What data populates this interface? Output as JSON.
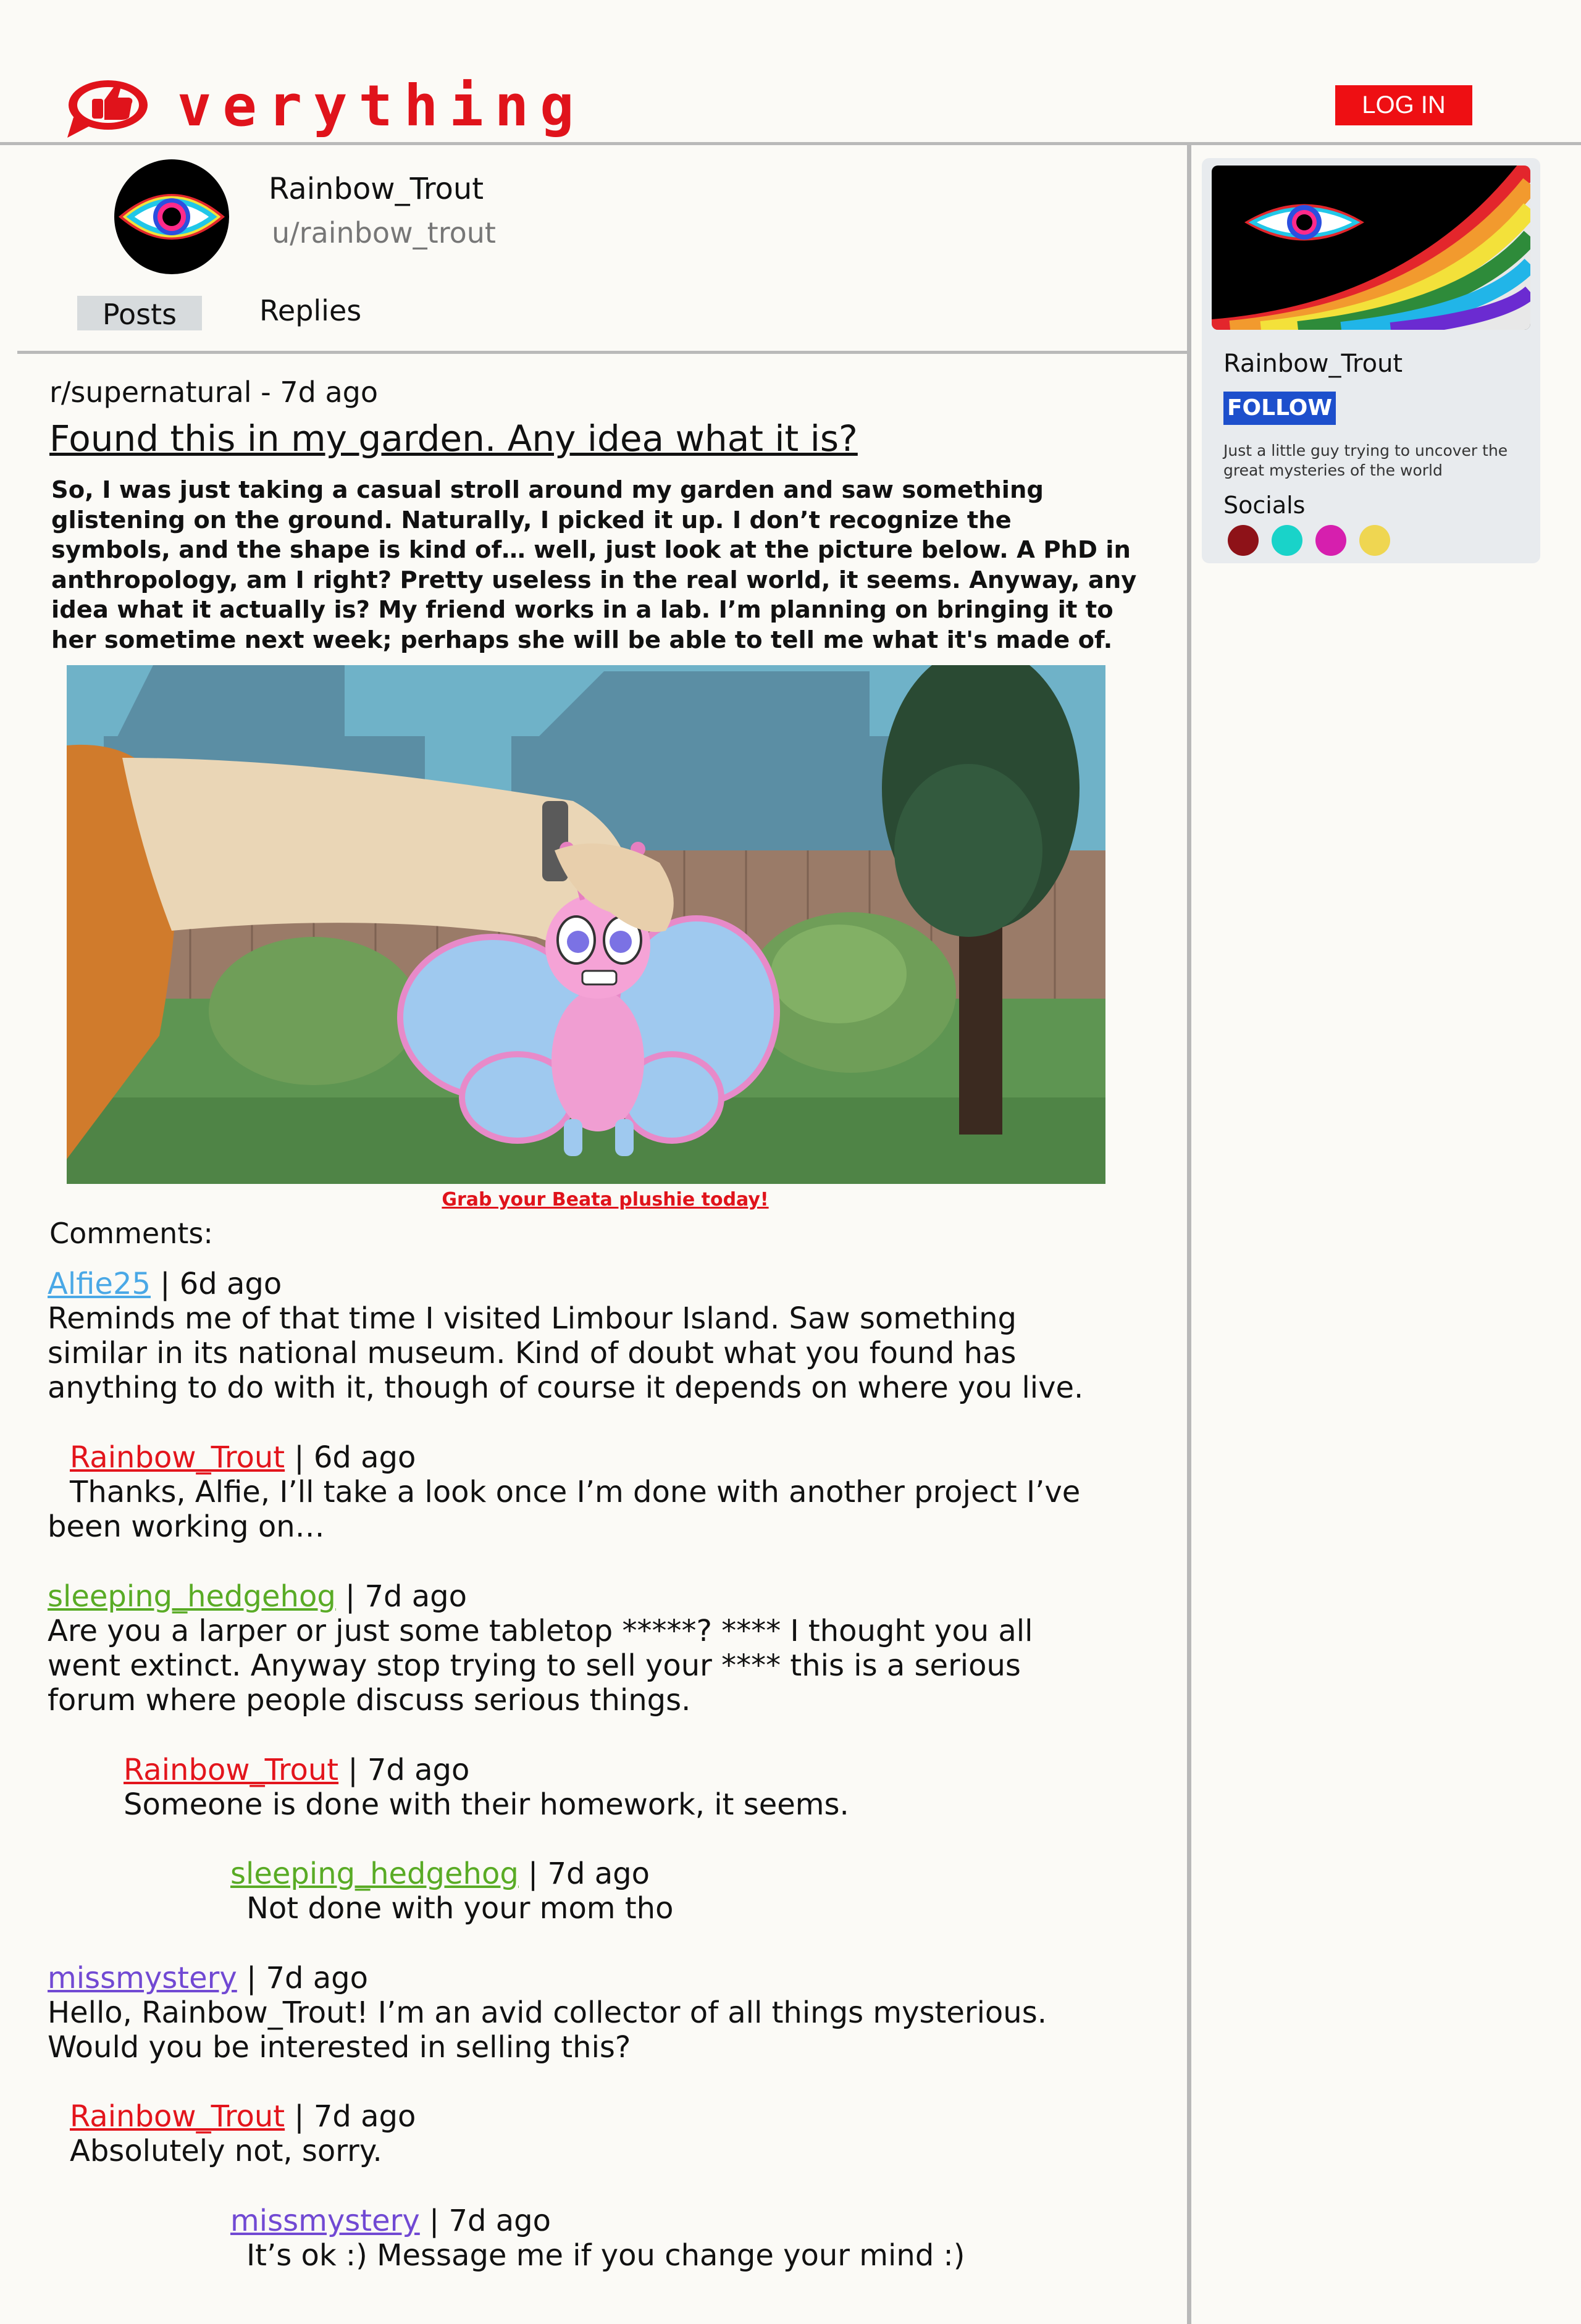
{
  "header": {
    "logo_text": "verything",
    "login_label": "LOG IN"
  },
  "profile": {
    "display_name": "Rainbow_Trout",
    "handle": "u/rainbow_trout",
    "tabs": [
      {
        "label": "Posts",
        "active": true
      },
      {
        "label": "Replies",
        "active": false
      }
    ]
  },
  "post": {
    "meta": "r/supernatural - 7d ago",
    "title": "Found this in my garden. Any idea what it is?",
    "body": "So, I was just taking a casual stroll around my garden and saw something glistening on the ground. Naturally, I picked it up. I don’t recognize the symbols, and the shape is kind of… well, just look at the picture below. A PhD in anthropology, am I right? Pretty useless in the real world, it seems. Anyway, any idea what it actually is? My friend works in a lab. I’m planning on bringing it to her sometime next week; perhaps she will be able to tell me what it's made of.",
    "promo_link": "Grab your Beata plushie today!"
  },
  "comments_heading": "Comments:",
  "comments": [
    {
      "user": "Alfie25",
      "time": " | 6d ago",
      "text": "Reminds me of that time I visited Limbour Island. Saw something similar in its national museum. Kind of doubt what you found has anything to do with it, though of course it depends on where you live.",
      "color": "#4aa8e6"
    },
    {
      "user": "Rainbow_Trout",
      "time": " | 6d ago",
      "text": "Thanks, Alfie, I’ll take a look once I’m done with another project I’ve been working on…",
      "color": "#e3151c"
    },
    {
      "user": "sleeping_hedgehog",
      "time": " | 7d ago",
      "text": "Are you a larper or just some tabletop *****? **** I thought you all went extinct. Anyway stop trying to sell your **** this is a serious forum where people discuss serious things.",
      "color": "#59ab25"
    },
    {
      "user": "Rainbow_Trout",
      "time": " | 7d ago",
      "text": "Someone is done with their homework, it seems.",
      "color": "#e3151c"
    },
    {
      "user": "sleeping_hedgehog",
      "time": " | 7d ago",
      "text": "Not done with your mom tho",
      "color": "#59ab25"
    },
    {
      "user": "missmystery",
      "time": " | 7d ago",
      "text": "Hello, Rainbow_Trout! I’m an avid collector of all things mysterious. Would you be interested in selling this?",
      "color": "#7149d3"
    },
    {
      "user": "Rainbow_Trout",
      "time": " | 7d ago",
      "text": "Absolutely not, sorry.",
      "color": "#e3151c"
    },
    {
      "user": "missmystery",
      "time": " | 7d ago",
      "text": "It’s ok :) Message me if you change your mind :)",
      "color": "#7149d3"
    }
  ],
  "sidebar": {
    "name": "Rainbow_Trout",
    "follow_label": "FOLLOW",
    "bio": "Just a little guy trying to uncover the great mysteries of the world",
    "socials_label": "Socials",
    "social_colors": [
      "#8e1218",
      "#19d3c9",
      "#d61fae",
      "#efd651"
    ]
  }
}
